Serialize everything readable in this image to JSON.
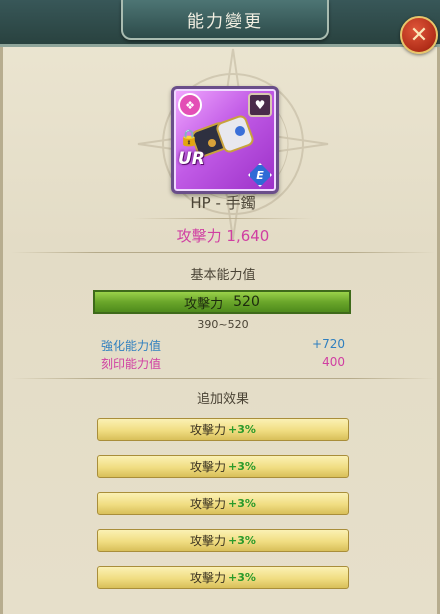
{
  "header": {
    "title": "能力變更"
  },
  "item": {
    "rarity": "UR",
    "element": "E",
    "name": "HP - 手鐲",
    "attack_summary": "攻擊力 1,640"
  },
  "base_stats": {
    "section_title": "基本能力值",
    "stat_label": "攻擊力",
    "stat_value": "520",
    "range": "390~520"
  },
  "bonus_stats": [
    {
      "label": "強化能力值",
      "value": "+720",
      "color": "#2f7fbf"
    },
    {
      "label": "刻印能力值",
      "value": "400",
      "color": "#d03fa2"
    }
  ],
  "extra_effects": {
    "section_title": "追加效果",
    "items": [
      {
        "label": "攻擊力",
        "bonus": "+3%"
      },
      {
        "label": "攻擊力",
        "bonus": "+3%"
      },
      {
        "label": "攻擊力",
        "bonus": "+3%"
      },
      {
        "label": "攻擊力",
        "bonus": "+3%"
      },
      {
        "label": "攻擊力",
        "bonus": "+3%"
      }
    ]
  },
  "icons": {
    "close": "close-icon",
    "lock": "lock-icon",
    "heart": "heart-icon",
    "badge": "gem-badge-icon"
  },
  "colors": {
    "accent_pink": "#d03fa2",
    "accent_blue": "#2f7fbf",
    "bar_green": "#6aa62a",
    "bar_gold": "#f0dd82"
  }
}
